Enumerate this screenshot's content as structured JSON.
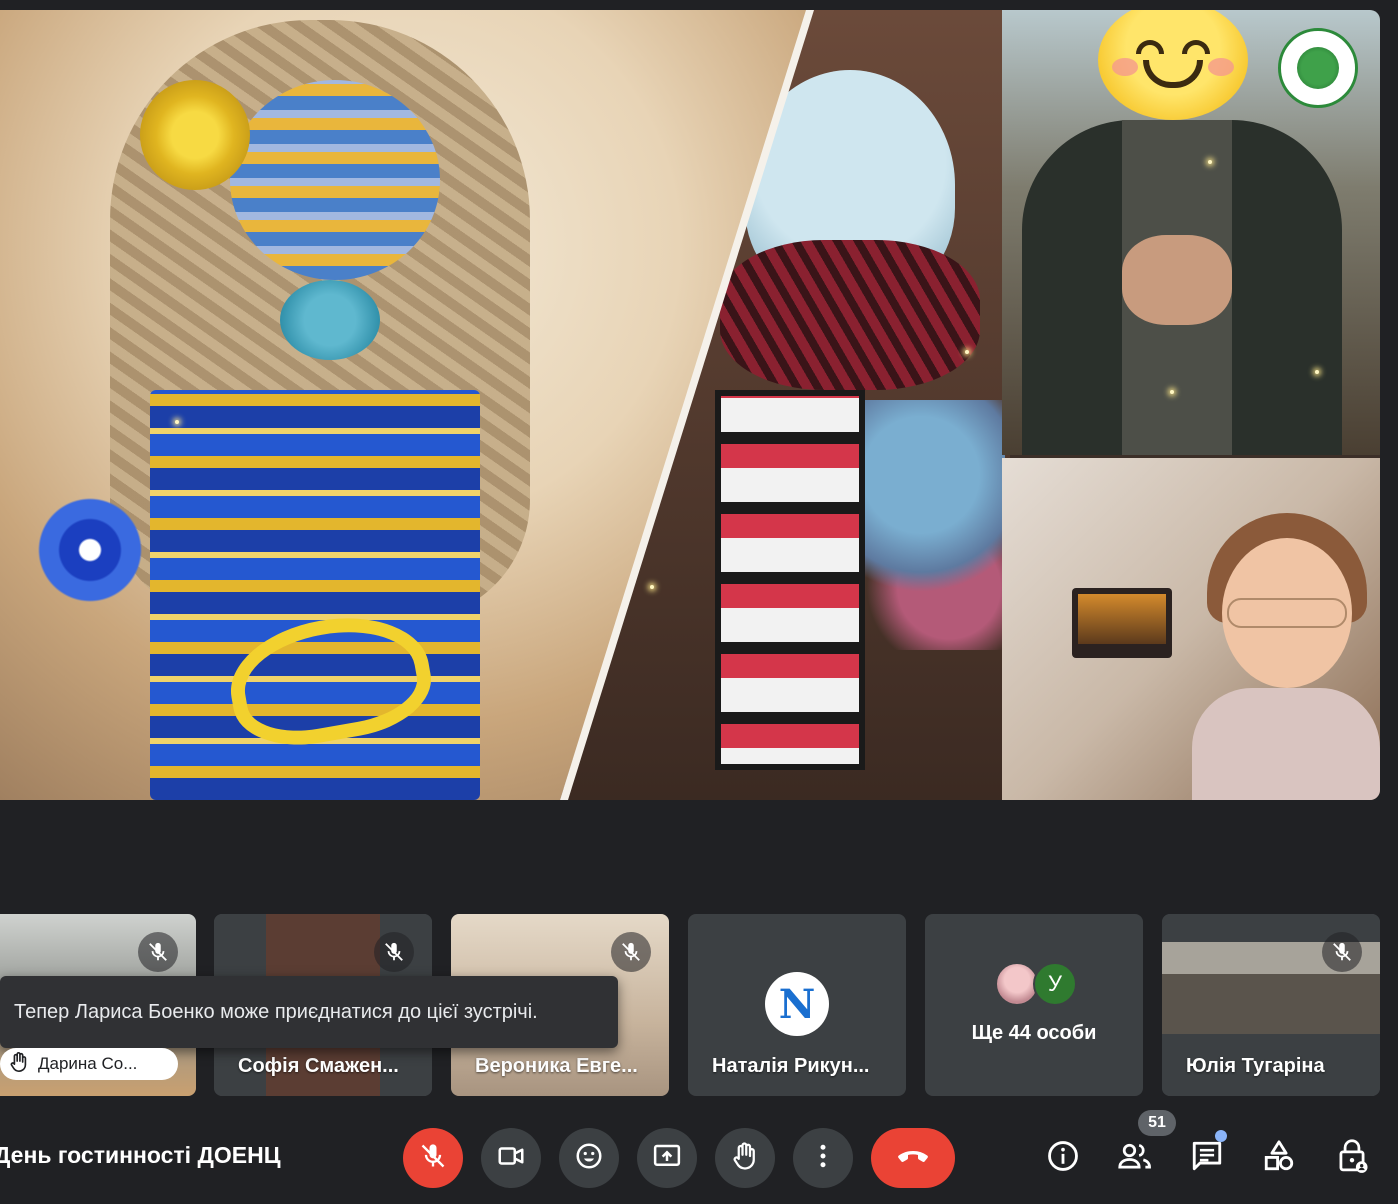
{
  "stage": {
    "org_logo": "ecology-center-logo"
  },
  "toast": {
    "text": "Тепер Лариса Боенко може приєднатися до цієї зустрічі."
  },
  "participants": [
    {
      "name": "Дарина Со...",
      "muted": true,
      "hand_raised": true
    },
    {
      "name": "Софія Смажен...",
      "muted": true
    },
    {
      "name": "Вероника Евге...",
      "muted": true
    },
    {
      "name": "Наталія Рикун...",
      "avatar_letter": "N"
    },
    {
      "others_label": "Ще 44 особи",
      "avatar_letter": "У"
    },
    {
      "name": "Юлія Тугаріна",
      "muted": true
    }
  ],
  "meeting": {
    "title": "День гостинності ДОЕНЦ"
  },
  "toolbar": {
    "mic": "mic-off-icon",
    "camera": "camera-icon",
    "emoji": "emoji-icon",
    "present": "present-screen-icon",
    "hand": "raise-hand-icon",
    "more": "more-options-icon",
    "end_call": "end-call-icon"
  },
  "side_controls": {
    "participants_count": "51",
    "info": "info-icon",
    "people": "people-icon",
    "chat": "chat-icon",
    "activities": "activities-icon",
    "host_controls": "host-controls-icon"
  },
  "colors": {
    "background": "#202124",
    "tile": "#3c4043",
    "danger": "#ea4335",
    "accent": "#8ab4f8"
  }
}
